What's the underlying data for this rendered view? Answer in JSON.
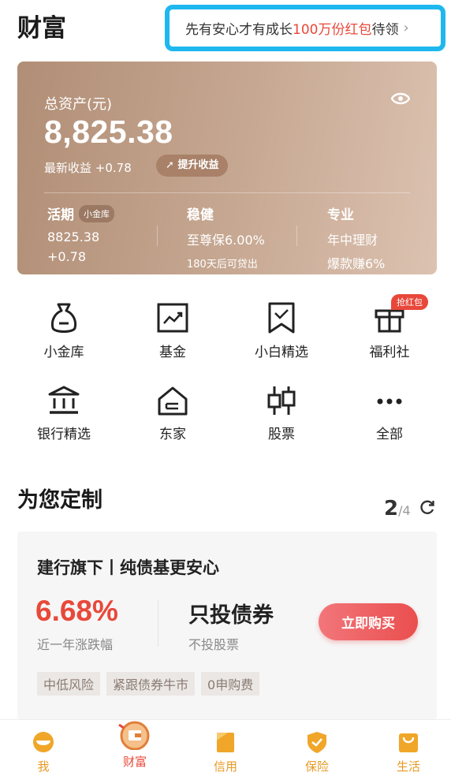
{
  "header": {
    "title": "财富",
    "promo": {
      "prefix": "先有安心才有成长 ",
      "highlight": "100万份红包",
      "suffix": "待领",
      "chevron": "›"
    }
  },
  "asset": {
    "label": "总资产(元)",
    "value": "8,825.38",
    "latest": "最新收益 +0.78",
    "boost_label": "提升收益",
    "eye_icon": "eye-icon",
    "columns": [
      {
        "title": "活期",
        "tag": "小金库",
        "line1": "8825.38",
        "line2": "+0.78"
      },
      {
        "title": "稳健",
        "line1": "至尊保6.00%",
        "line2": "180天后可贷出"
      },
      {
        "title": "专业",
        "line1": "年中理财",
        "line2": "爆款赚6%"
      }
    ]
  },
  "quick_grid": {
    "items": [
      {
        "label": "小金库",
        "icon": "money-bag-icon"
      },
      {
        "label": "基金",
        "icon": "chart-icon"
      },
      {
        "label": "小白精选",
        "icon": "bookmark-icon"
      },
      {
        "label": "福利社",
        "icon": "gift-icon"
      },
      {
        "label": "银行精选",
        "icon": "bank-icon"
      },
      {
        "label": "东家",
        "icon": "house-icon"
      },
      {
        "label": "股票",
        "icon": "candlestick-icon"
      },
      {
        "label": "全部",
        "icon": "more-icon"
      }
    ],
    "badge": "抢红包"
  },
  "section": {
    "title": "为您定制",
    "page_current": "2",
    "page_total": "/4"
  },
  "product": {
    "title": "建行旗下丨纯债基更安心",
    "rate": "6.68%",
    "rate_label": "近一年涨跌幅",
    "type": "只投债券",
    "type_sub": "不投股票",
    "buy_label": "立即购买",
    "tags": [
      "中低风险",
      "紧跟债券牛市",
      "0申购费"
    ]
  },
  "tabbar": {
    "items": [
      {
        "label": "我",
        "icon": "face-icon"
      },
      {
        "label": "财富",
        "icon": "wallet-icon",
        "active": true
      },
      {
        "label": "信用",
        "icon": "card-icon"
      },
      {
        "label": "保险",
        "icon": "shield-icon"
      },
      {
        "label": "生活",
        "icon": "bag-icon"
      }
    ]
  },
  "colors": {
    "accent": "#e8483a",
    "promo_border": "#1eb8ef",
    "tab_icon": "#e89a24"
  }
}
